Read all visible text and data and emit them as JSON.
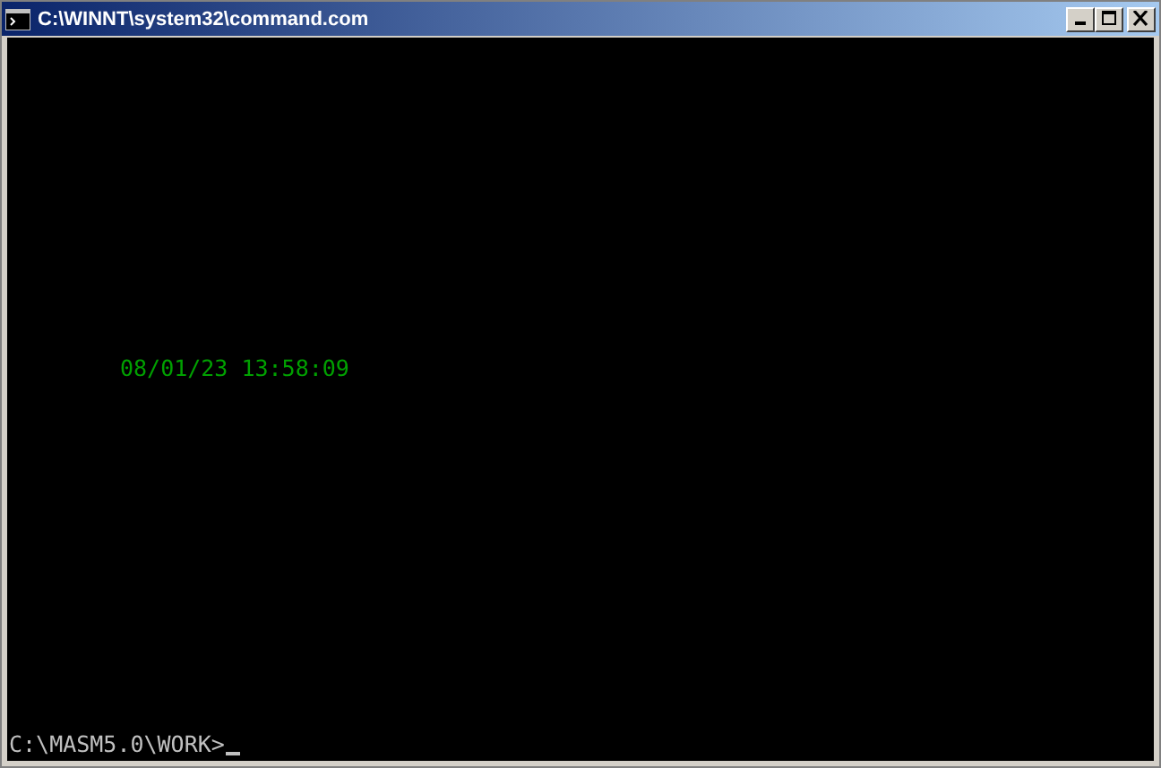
{
  "window": {
    "title": "C:\\WINNT\\system32\\command.com",
    "buttons": [
      {
        "kind": "minimize"
      },
      {
        "kind": "maximize"
      },
      {
        "kind": "close"
      }
    ]
  },
  "console": {
    "lines": [
      {
        "text": "08/01/23 13:58:09",
        "color": "#00a000"
      }
    ],
    "prompt": "C:\\MASM5.0\\WORK>"
  }
}
